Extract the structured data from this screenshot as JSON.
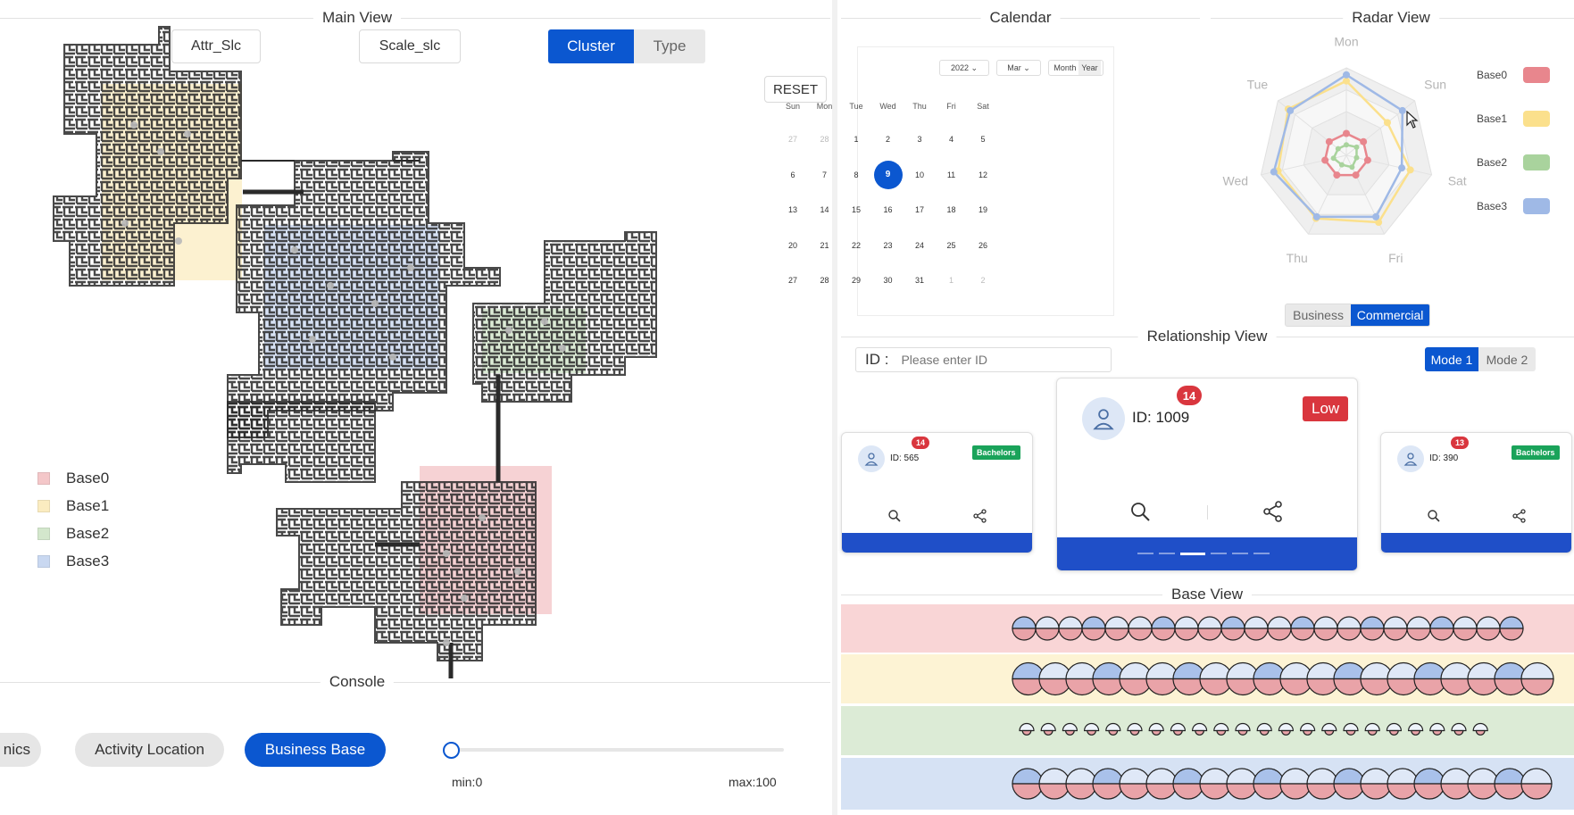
{
  "main_view": {
    "title": "Main View",
    "attr_btn": "Attr_Slc",
    "scale_btn": "Scale_slc",
    "toggle": {
      "left": "Cluster",
      "right": "Type",
      "active": "Cluster"
    },
    "reset_btn": "RESET",
    "legend": [
      {
        "label": "Base0",
        "color": "#f4c7c9"
      },
      {
        "label": "Base1",
        "color": "#fbecc0"
      },
      {
        "label": "Base2",
        "color": "#d3e7cc"
      },
      {
        "label": "Base3",
        "color": "#c9d8f1"
      }
    ]
  },
  "console": {
    "title": "Console",
    "buttons": [
      "nics",
      "Activity Location",
      "Business Base"
    ],
    "active": "Business Base",
    "slider": {
      "min_label": "min:0",
      "max_label": "max:100",
      "value": 0
    }
  },
  "calendar": {
    "title": "Calendar",
    "year": "2022",
    "month": "Mar",
    "mode_month": "Month",
    "mode_year": "Year",
    "weekdays": [
      "Sun",
      "Mon",
      "Tue",
      "Wed",
      "Thu",
      "Fri",
      "Sat"
    ],
    "weeks": [
      [
        "27",
        "28",
        "1",
        "2",
        "3",
        "4",
        "5"
      ],
      [
        "6",
        "7",
        "8",
        "9",
        "10",
        "11",
        "12"
      ],
      [
        "13",
        "14",
        "15",
        "16",
        "17",
        "18",
        "19"
      ],
      [
        "20",
        "21",
        "22",
        "23",
        "24",
        "25",
        "26"
      ],
      [
        "27",
        "28",
        "29",
        "30",
        "31",
        "1",
        "2"
      ]
    ],
    "selected": "9"
  },
  "radar": {
    "title": "Radar View",
    "axes": [
      "Mon",
      "Sun",
      "Sat",
      "Fri",
      "Thu",
      "Wed",
      "Tue"
    ],
    "legend": [
      {
        "label": "Base0",
        "color": "#e8868d"
      },
      {
        "label": "Base1",
        "color": "#fbe08c"
      },
      {
        "label": "Base2",
        "color": "#a9d39d"
      },
      {
        "label": "Base3",
        "color": "#9fb9e6"
      }
    ],
    "series": [
      {
        "values": [
          0.25,
          0.25,
          0.25,
          0.25,
          0.25,
          0.25,
          0.25
        ]
      },
      {
        "values": [
          0.85,
          0.6,
          0.75,
          0.85,
          0.8,
          0.8,
          0.85
        ]
      },
      {
        "values": [
          0.12,
          0.15,
          0.12,
          0.15,
          0.12,
          0.15,
          0.12
        ]
      },
      {
        "values": [
          0.92,
          0.82,
          0.65,
          0.78,
          0.78,
          0.85,
          0.82
        ]
      }
    ],
    "toggle": {
      "left": "Business",
      "right": "Commercial",
      "active": "Commercial"
    }
  },
  "relationship": {
    "title": "Relationship View",
    "id_label": "ID :",
    "id_placeholder": "Please enter ID",
    "mode": {
      "left": "Mode 1",
      "right": "Mode 2",
      "active": "Mode 1"
    },
    "cards": [
      {
        "id": "ID: 565",
        "count": "14",
        "tag": "Bachelors"
      },
      {
        "id": "ID: 1009",
        "count": "14",
        "tag": "Low"
      },
      {
        "id": "ID: 390",
        "count": "13",
        "tag": "Bachelors"
      }
    ]
  },
  "base_view": {
    "title": "Base View",
    "rows": [
      {
        "color": "#f9d5d6",
        "count": 22
      },
      {
        "color": "#fdf3d4",
        "count": 22
      },
      {
        "color": "#dcebd6",
        "count": 22
      },
      {
        "color": "#d6e2f4",
        "count": 22
      }
    ]
  }
}
